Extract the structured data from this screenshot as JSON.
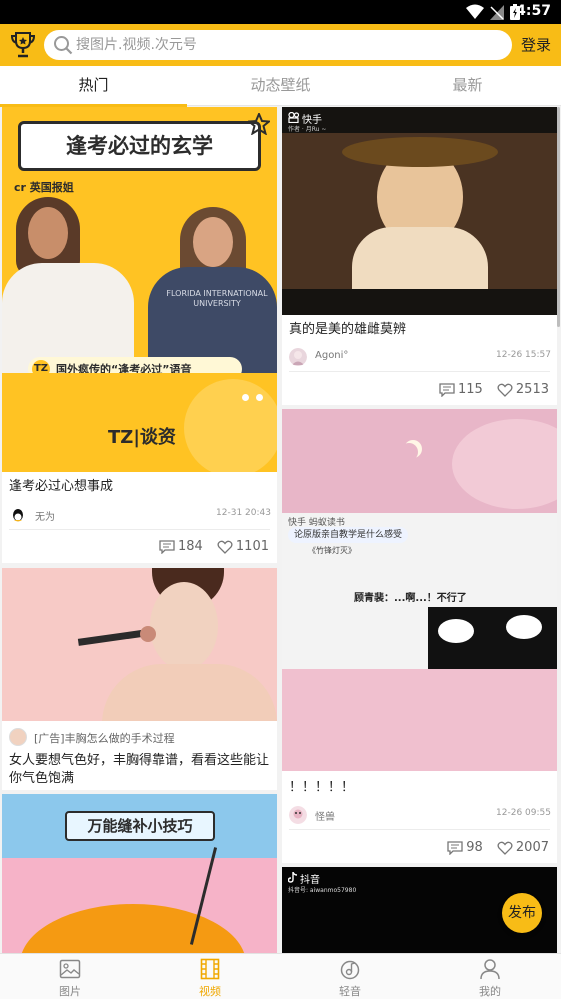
{
  "status_bar": {
    "time": "4:57"
  },
  "header": {
    "search_placeholder": "搜图片.视频.次元号",
    "login_label": "登录"
  },
  "tabs": [
    {
      "label": "热门",
      "active": true
    },
    {
      "label": "动态壁纸",
      "active": false
    },
    {
      "label": "最新",
      "active": false
    }
  ],
  "feed": {
    "left": [
      {
        "thumb": {
          "banner": "逢考必过的玄学",
          "tag": "cr 英国报姐",
          "caption": "国外疯传的“逢考必过”语音",
          "brand": "TZ|谈资",
          "shirt_text": "FLORIDA INTERNATIONAL UNIVERSITY"
        },
        "title": "逢考必过心想事成",
        "user": "无为",
        "date": "12-31 20:43",
        "comments": "184",
        "likes": "1101"
      },
      {
        "ad_label": "[广告]丰胸怎么做的手术过程",
        "title": "女人要想气色好，丰胸得靠谱，看看这些能让你气色饱满"
      },
      {
        "thumb": {
          "banner": "万能缝补小技巧"
        }
      }
    ],
    "right": [
      {
        "thumb": {
          "brand": "快手",
          "sub": "作者 · 月Ru ~"
        },
        "title": "真的是美的雄雌莫辨",
        "user": "Agoni°",
        "date": "12-26 15:57",
        "comments": "115",
        "likes": "2513"
      },
      {
        "thumb": {
          "brand": "快手 蚂蚁读书",
          "bubble": "论原版亲自教学是什么感受",
          "sub": "《竹锋灯灭》",
          "dialog": "顾青裴：...啊...！不行了"
        },
        "title": "！！！！！",
        "user": "怪兽",
        "date": "12-26 09:55",
        "comments": "98",
        "likes": "2007"
      },
      {
        "thumb": {
          "brand": "抖音",
          "sub": "抖音号: aiwanmo57980"
        }
      }
    ]
  },
  "fab_label": "发布",
  "bottom_nav": [
    {
      "label": "图片",
      "icon": "image-icon",
      "active": false
    },
    {
      "label": "视频",
      "icon": "film-icon",
      "active": true
    },
    {
      "label": "轻音",
      "icon": "music-disc-icon",
      "active": false
    },
    {
      "label": "我的",
      "icon": "person-icon",
      "active": false
    }
  ],
  "colors": {
    "accent": "#f8bc16",
    "active_nav": "#f0a800"
  }
}
